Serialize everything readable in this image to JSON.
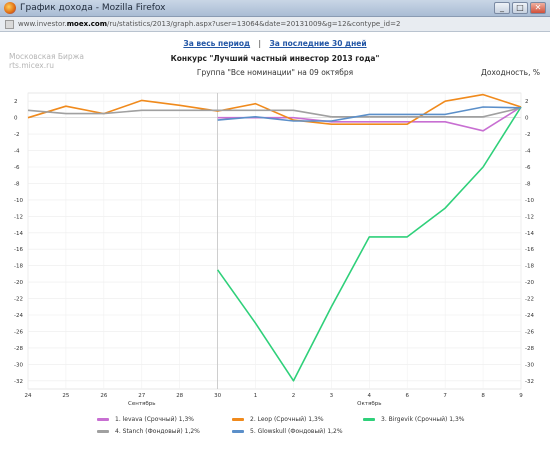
{
  "window": {
    "title": "График дохода - Mozilla Firefox",
    "url_prefix": "www.investor.",
    "url_domain": "moex.com",
    "url_suffix": "/ru/statistics/2013/graph.aspx?user=13064&date=20131009&g=12&contype_id=2",
    "minimize": "_",
    "maximize": "□",
    "close": "✕"
  },
  "links": {
    "all_period": "За весь период",
    "separator": "|",
    "last_30_days": "За последние 30 дней"
  },
  "watermark": {
    "line1": "Московская Биржа",
    "line2": "rts.micex.ru"
  },
  "chart_header": {
    "title": "Конкурс \"Лучший частный инвестор 2013 года\"",
    "subtitle": "Группа \"Все номинации\" на 09 октября",
    "yield_label": "Доходность, %"
  },
  "chart_data": {
    "type": "line",
    "categories": [
      "24",
      "25",
      "26",
      "27",
      "28",
      "30",
      "1",
      "2",
      "3",
      "4",
      "6",
      "7",
      "8",
      "9"
    ],
    "month_labels": [
      {
        "label": "Сентябрь",
        "at": "27"
      },
      {
        "label": "Октябрь",
        "at": "4"
      }
    ],
    "yticks": [
      2,
      0,
      -2,
      -4,
      -6,
      -8,
      -10,
      -12,
      -14,
      -16,
      -18,
      -20,
      -22,
      -24,
      -26,
      -28,
      -30,
      -32
    ],
    "ylim": [
      -33,
      3
    ],
    "grid": true,
    "series": [
      {
        "name": "1. levava (Срочный)",
        "legend_value": "1,3%",
        "color": "#c86fd2",
        "values": [
          null,
          null,
          null,
          null,
          null,
          0,
          0,
          0,
          -0.5,
          -0.5,
          -0.5,
          -0.5,
          -1.6,
          1.3
        ]
      },
      {
        "name": "2. Leop (Срочный)",
        "legend_value": "1,3%",
        "color": "#f08a1c",
        "values": [
          0,
          1.4,
          0.5,
          2.1,
          1.5,
          0.8,
          1.7,
          -0.3,
          -0.8,
          -0.8,
          -0.8,
          2.0,
          2.8,
          1.3
        ]
      },
      {
        "name": "3. Birgevik (Срочный)",
        "legend_value": "1,3%",
        "color": "#2fd07a",
        "values": [
          null,
          null,
          null,
          null,
          null,
          -18.5,
          -25,
          -32,
          -23,
          -14.5,
          -14.5,
          -11,
          -6,
          1.3
        ]
      },
      {
        "name": "4. Stanch (Фондовый)",
        "legend_value": "1,2%",
        "color": "#a0a0a0",
        "values": [
          0.9,
          0.5,
          0.5,
          0.9,
          0.9,
          0.9,
          0.9,
          0.9,
          0.1,
          0.1,
          0.1,
          0.1,
          0.1,
          1.2
        ]
      },
      {
        "name": "5. Glowskull (Фондовый)",
        "legend_value": "1,2%",
        "color": "#5b8fc9",
        "values": [
          null,
          null,
          null,
          null,
          null,
          -0.3,
          0.1,
          -0.4,
          -0.4,
          0.4,
          0.4,
          0.4,
          1.3,
          1.2
        ]
      }
    ]
  }
}
